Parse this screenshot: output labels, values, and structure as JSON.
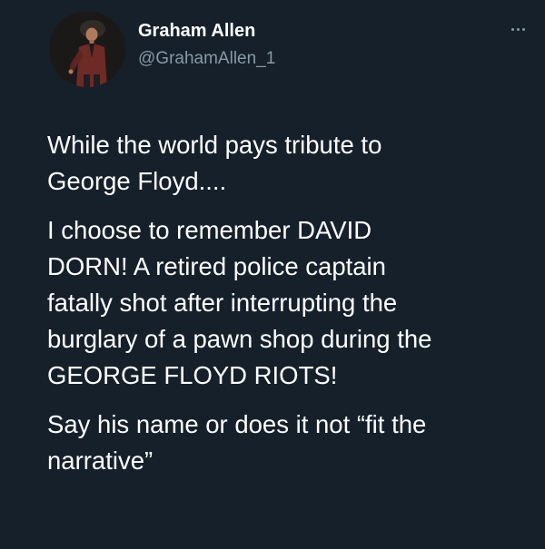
{
  "author": {
    "display_name": "Graham Allen",
    "handle": "@GrahamAllen_1",
    "avatar_icon": "profile-photo"
  },
  "menu": {
    "icon": "more-options-icon"
  },
  "tweet": {
    "paragraphs": [
      [
        "While the world pays tribute to",
        "George Floyd...."
      ],
      [
        "I choose to remember DAVID",
        "DORN! A retired police captain",
        "fatally shot after interrupting the",
        "burglary of a pawn shop during the",
        "GEORGE FLOYD RIOTS!"
      ],
      [
        "Say his name or does it not “fit the",
        "narrative”"
      ]
    ]
  },
  "colors": {
    "background": "#15202b",
    "text": "#ffffff",
    "secondary": "#8899a6"
  }
}
